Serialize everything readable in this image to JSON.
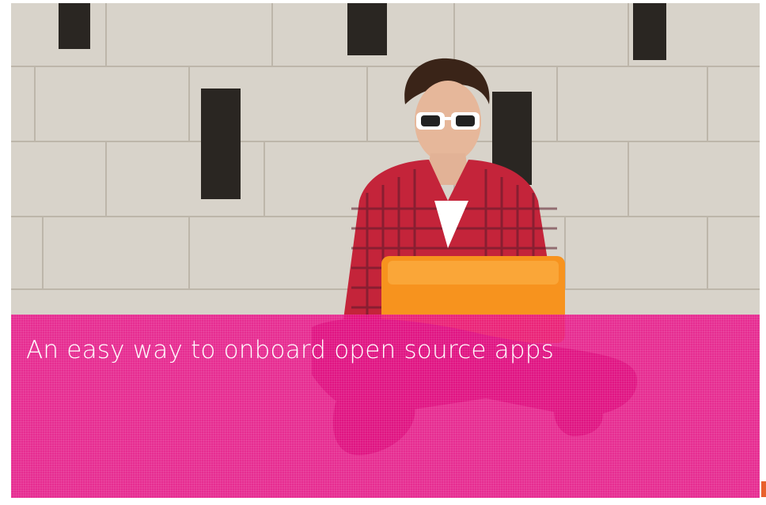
{
  "hero": {
    "headline": "An easy way to onboard open source apps"
  },
  "colors": {
    "banner_overlay": "#e81287",
    "laptop": "#f7931e",
    "wall": "#d9d4cb",
    "shirt": "#c4243a"
  },
  "image": {
    "subject": "person-with-sunglasses-and-orange-laptop-sitting-against-brick-wall"
  }
}
